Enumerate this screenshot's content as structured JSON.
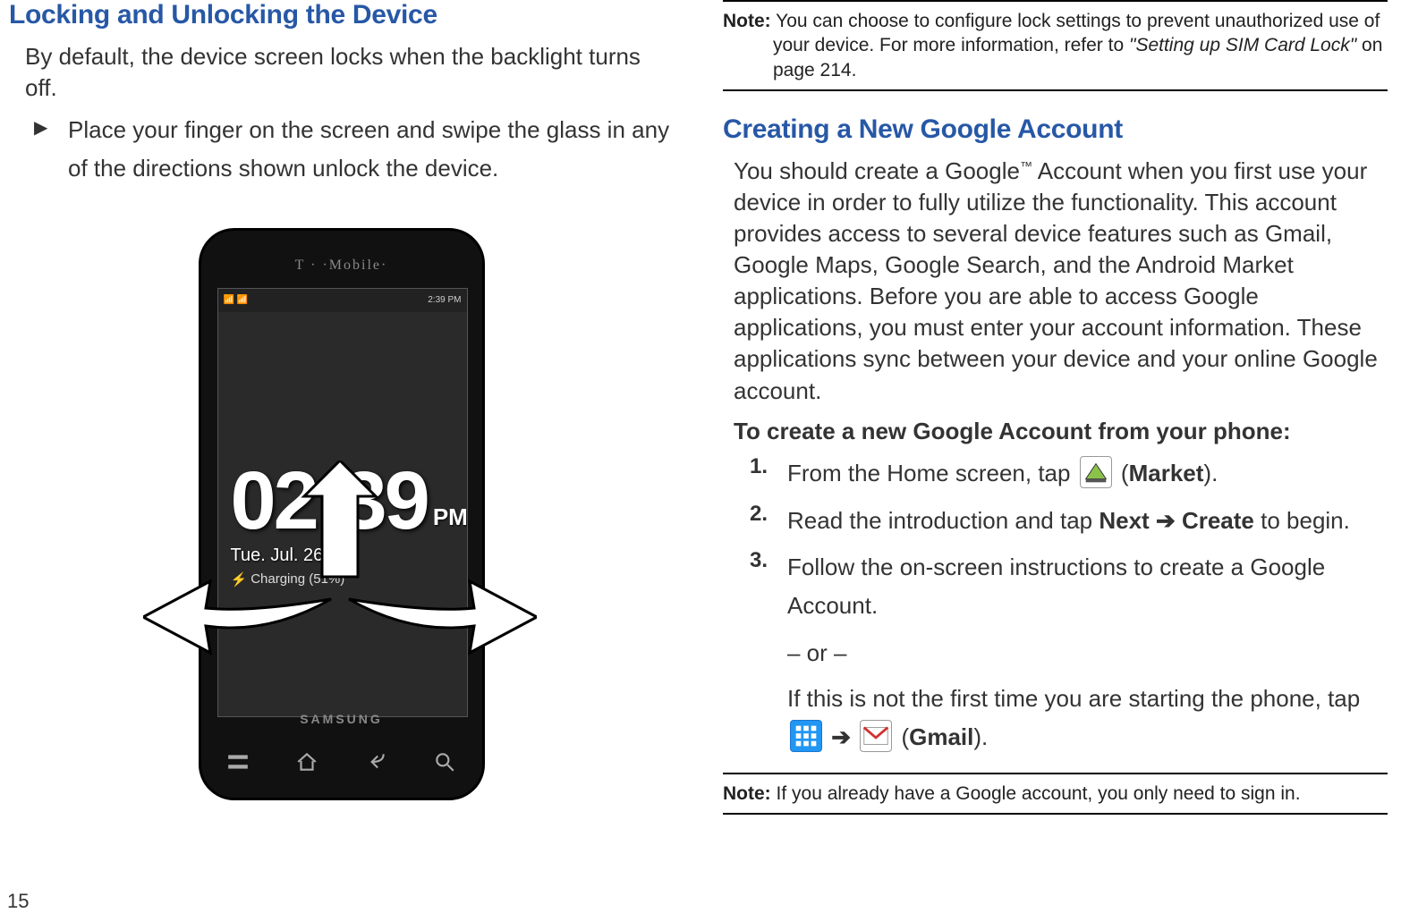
{
  "left": {
    "heading": "Locking and Unlocking the Device",
    "intro": "By default, the device screen locks when the backlight turns off.",
    "bullet": "Place your finger on the screen and swipe the glass in any of the directions shown unlock the device.",
    "page_number": "15",
    "phone": {
      "carrier": "T · ·Mobile·",
      "status_time": "2:39 PM",
      "clock_time": "02:39",
      "clock_ampm": "PM",
      "date": "Tue. Jul. 26",
      "charging": "Charging (51%)",
      "brand": "SAMSUNG"
    }
  },
  "right": {
    "note1": {
      "label": "Note:",
      "text_a": " You can choose to configure lock settings to prevent unauthorized use of your device. For more information, refer to ",
      "ref": "\"Setting up SIM Card Lock\" ",
      "text_b": " on page 214."
    },
    "heading": "Creating a New Google Account",
    "intro_a": "You should create a Google",
    "tm": "™",
    "intro_b": " Account when you first use your device in order to fully utilize the functionality. This account provides access to several device features such as Gmail, Google Maps, Google Search, and the Android Market applications. Before you are able to access Google applications, you must enter your account information. These applications sync between your device and your online Google account.",
    "subheading": "To create a new Google Account from your phone:",
    "steps": {
      "s1_num": "1.",
      "s1_a": "From the Home screen, tap ",
      "s1_b": " (",
      "s1_bold": "Market",
      "s1_c": ").",
      "s2_num": "2.",
      "s2_a": "Read the introduction and tap ",
      "s2_bold_a": "Next",
      "s2_arrow": " ➔ ",
      "s2_bold_b": "Create",
      "s2_c": " to begin.",
      "s3_num": "3.",
      "s3_a": "Follow the on-screen instructions to create a Google Account.",
      "or": "– or –",
      "alt_a": "If this is not the first time you are starting the phone, tap ",
      "alt_arrow": " ➔ ",
      "alt_b": " (",
      "alt_bold": "Gmail",
      "alt_c": ")."
    },
    "note2": {
      "label": "Note:",
      "text": " If you already have a Google account, you only need to sign in."
    }
  }
}
